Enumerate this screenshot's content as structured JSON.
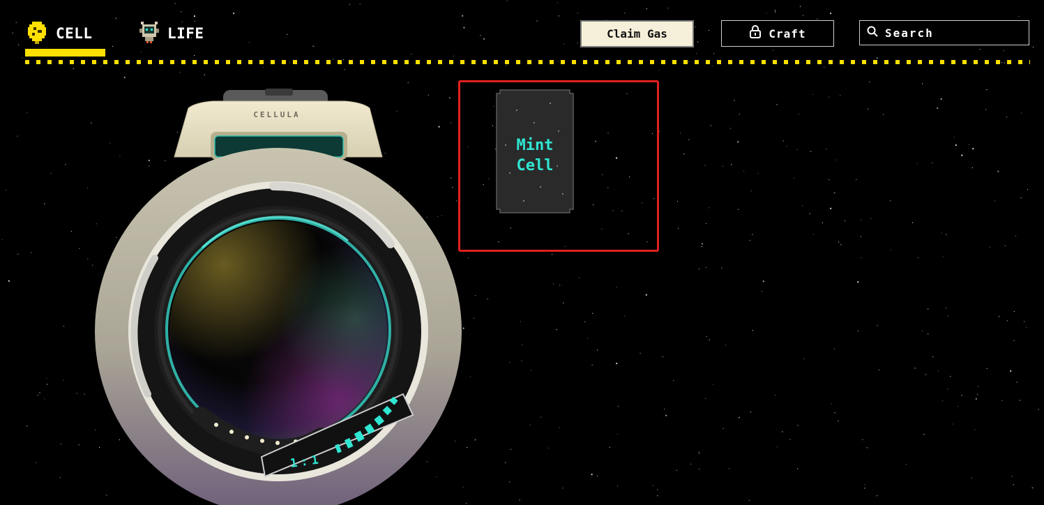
{
  "nav": {
    "tabs": [
      {
        "label": "CELL",
        "icon": "cell-icon",
        "active": true
      },
      {
        "label": "LIFE",
        "icon": "robot-icon",
        "active": false
      }
    ],
    "accent_color": "#ffe000"
  },
  "header": {
    "claim_gas_label": "Claim Gas",
    "craft_label": "Craft",
    "search_placeholder": "Search"
  },
  "mint_card": {
    "line1": "Mint",
    "line2": "Cell",
    "text_color": "#2fe6d2",
    "highlight_color": "#e02020"
  },
  "device": {
    "brand": "CELLULA",
    "zoom_label": "1:1"
  }
}
